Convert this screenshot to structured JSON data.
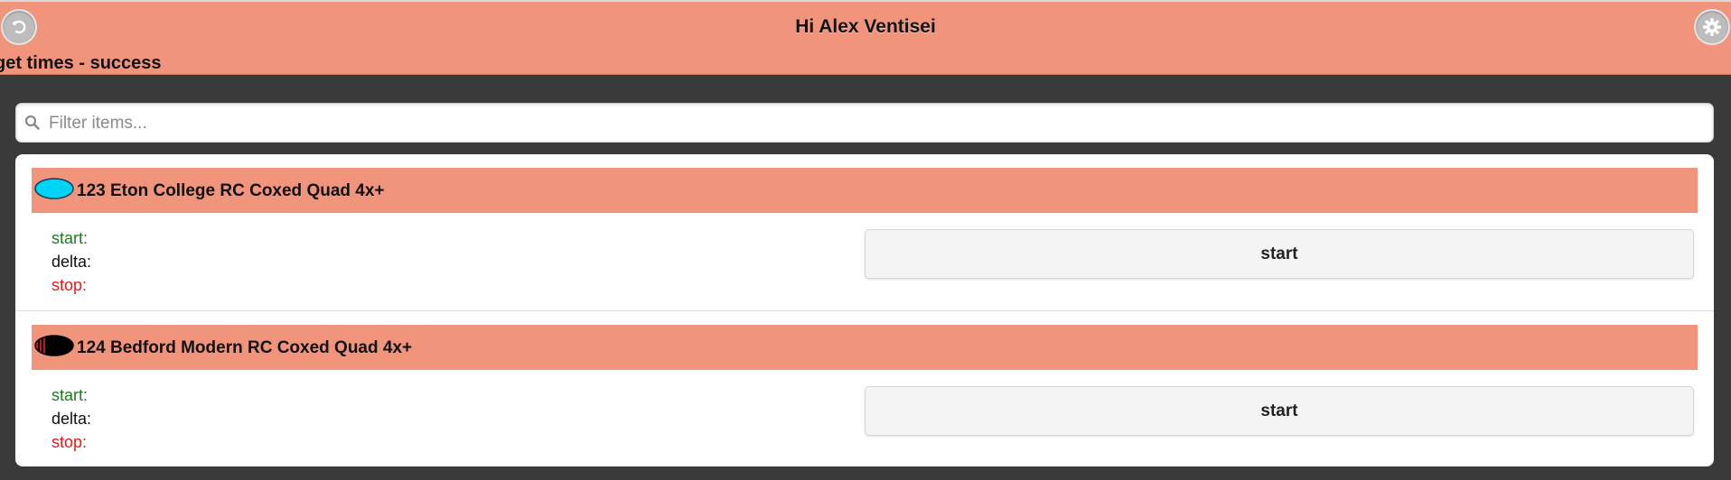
{
  "header": {
    "title": "Hi Alex Ventisei",
    "status": "get times - success",
    "back_icon": "back-arrow-icon",
    "settings_icon": "gear-icon",
    "color": "#f0957c"
  },
  "search": {
    "placeholder": "Filter items...",
    "value": "",
    "icon": "search-icon"
  },
  "items": [
    {
      "title": "123 Eton College RC Coxed Quad 4x+",
      "blade_icon": "blade-cyan-icon",
      "blade_color": "#00d4f5",
      "start_label": "start:",
      "delta_label": "delta:",
      "stop_label": "stop:",
      "button_label": "start"
    },
    {
      "title": "124 Bedford Modern RC Coxed Quad 4x+",
      "blade_icon": "blade-black-red-stripes-icon",
      "blade_color": "#000000",
      "start_label": "start:",
      "delta_label": "delta:",
      "stop_label": "stop:",
      "button_label": "start"
    }
  ],
  "colors": {
    "start_label": "#1e7a1e",
    "stop_label": "#e01b1b",
    "item_header": "#f0957c",
    "background": "#3a3a3a"
  }
}
